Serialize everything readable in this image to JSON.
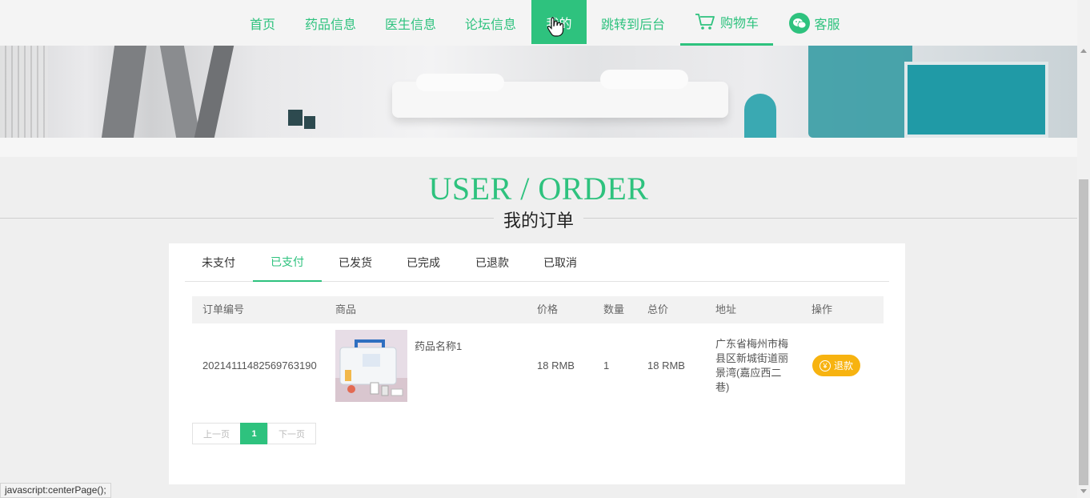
{
  "nav": {
    "items": [
      {
        "label": "首页"
      },
      {
        "label": "药品信息"
      },
      {
        "label": "医生信息"
      },
      {
        "label": "论坛信息"
      },
      {
        "label": "我的"
      },
      {
        "label": "跳转到后台"
      },
      {
        "label": "购物车"
      },
      {
        "label": "客服"
      }
    ],
    "active_index": 4
  },
  "heading": {
    "en": "USER / ORDER",
    "cn": "我的订单"
  },
  "tabs": [
    {
      "label": "未支付"
    },
    {
      "label": "已支付"
    },
    {
      "label": "已发货"
    },
    {
      "label": "已完成"
    },
    {
      "label": "已退款"
    },
    {
      "label": "已取消"
    }
  ],
  "active_tab_index": 1,
  "table": {
    "headers": [
      "订单编号",
      "商品",
      "价格",
      "数量",
      "总价",
      "地址",
      "操作"
    ],
    "rows": [
      {
        "order_no": "20214111482569763190",
        "product_name": "药品名称1",
        "price": "18 RMB",
        "qty": "1",
        "total": "18 RMB",
        "address": "广东省梅州市梅县区新城街道丽景湾(嘉应西二巷)",
        "action": "退款"
      }
    ]
  },
  "pager": {
    "prev": "上一页",
    "current": "1",
    "next": "下一页"
  },
  "status_bar": "javascript:centerPage();",
  "colors": {
    "accent": "#2ec27e",
    "refund": "#f7b310"
  }
}
